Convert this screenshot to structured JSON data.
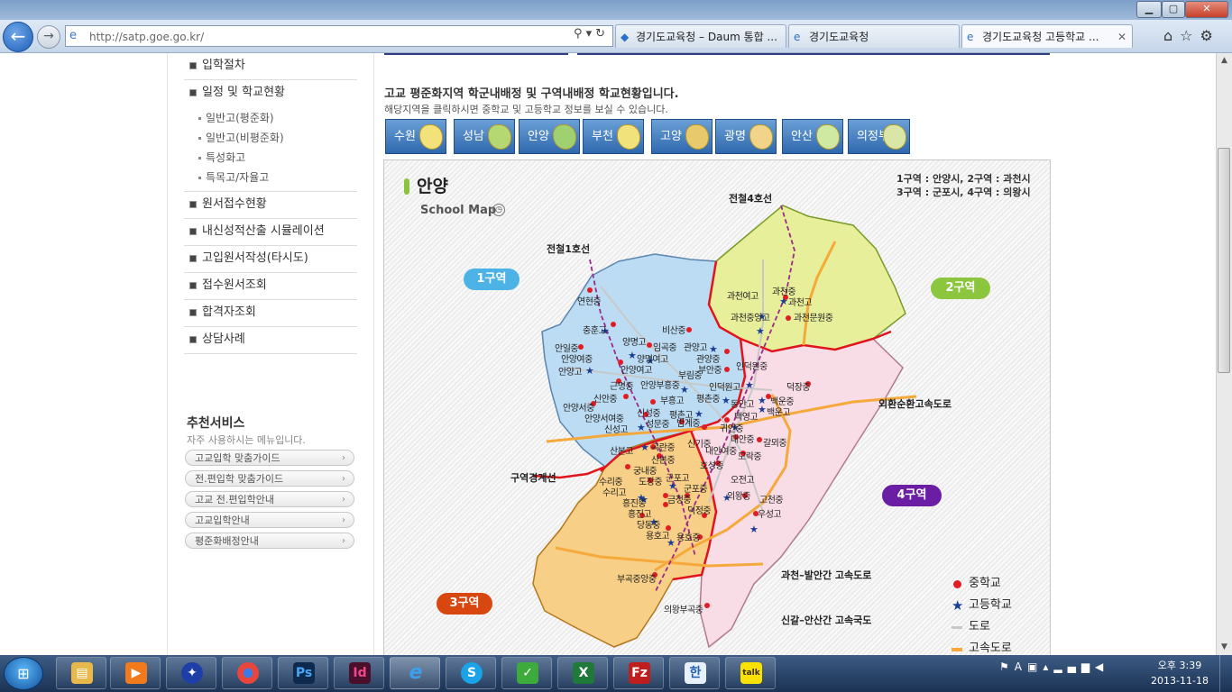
{
  "browser": {
    "address": "http://satp.goe.go.kr/",
    "tabs": [
      {
        "title": "경기도교육청 – Daum 통합 ..."
      },
      {
        "title": "경기도교육청"
      },
      {
        "title": "경기도교육청 고등학교 ...",
        "active": true
      }
    ]
  },
  "sidebar": {
    "menu_top": [
      {
        "label": "입학절차"
      },
      {
        "label": "일정 및 학교현황"
      }
    ],
    "sub_items": [
      "일반고(평준화)",
      "일반고(비평준화)",
      "특성화고",
      "특목고/자율고"
    ],
    "menu_bottom": [
      {
        "label": "원서접수현황"
      },
      {
        "label": "내신성적산출 시뮬레이션"
      },
      {
        "label": "고입원서작성(타시도)"
      },
      {
        "label": "접수원서조회"
      },
      {
        "label": "합격자조회"
      },
      {
        "label": "상담사례"
      }
    ],
    "recommend": {
      "title": "추천서비스",
      "desc": "자주 사용하시는 메뉴입니다.",
      "buttons": [
        "고교입학 맞춤가이드",
        "전.편입학 맞춤가이드",
        "고교 전.편입학안내",
        "고교입학안내",
        "평준화배정안내"
      ]
    }
  },
  "content": {
    "heading": "고교 평준화지역 학군내배정 및 구역내배정 학교현황입니다.",
    "desc": "해당지역을 클릭하시면 중학교 및 고등학교 정보를 보실 수 있습니다.",
    "regions": [
      "수원",
      "성남",
      "안양",
      "부천",
      "고양",
      "광명",
      "안산",
      "의정부"
    ],
    "region_colors": [
      "#f3e27a",
      "#b5d872",
      "#9fd173",
      "#f2e27b",
      "#e8c96c",
      "#f1d48a",
      "#cfe8a2",
      "#d9e6a6"
    ]
  },
  "map": {
    "title": "안양",
    "subtitle": "School Map",
    "district_note_1": "1구역 : 안양시, 2구역 : 과천시",
    "district_note_2": "3구역 : 군포시, 4구역 : 의왕시",
    "districts": [
      {
        "label": "1구역",
        "color": "#4db3e6"
      },
      {
        "label": "2구역",
        "color": "#8cc63f"
      },
      {
        "label": "3구역",
        "color": "#d7470f"
      },
      {
        "label": "4구역",
        "color": "#6a1ea3"
      }
    ],
    "lines": {
      "line4": "전철4호선",
      "line1": "전철1호선",
      "border": "구역경계선",
      "ring": "외환순환고속도로",
      "gwacheon_balan": "과천–발안간 고속도로",
      "singal_ansan": "신갈–안산간 고속국도"
    },
    "legend": [
      "중학교",
      "고등학교",
      "도로",
      "고속도로"
    ],
    "schools": [
      "과천여고",
      "과천중",
      "과천고",
      "과천중앙고",
      "과천문원중",
      "연현중",
      "충훈고",
      "비산중",
      "안일중",
      "안양여중",
      "안양고",
      "양명고",
      "임곡중",
      "양명여고",
      "안양여고",
      "관양고",
      "관양중",
      "부안중",
      "인덕원중",
      "부림중",
      "인덕원고",
      "안양부흥중",
      "근명중",
      "부흥고",
      "평촌중",
      "동안고",
      "신안중",
      "안양서중",
      "안양서여중",
      "신성중",
      "신성고",
      "성문중",
      "평촌고",
      "범계중",
      "백영고",
      "귀인중",
      "대안중",
      "갈뫼중",
      "덕장중",
      "백운중",
      "백운고",
      "산본고",
      "곡란중",
      "신기중",
      "내안여중",
      "모락중",
      "산본중",
      "호성중",
      "궁내중",
      "수리중",
      "도장중",
      "군포고",
      "수리고",
      "군포중",
      "금정중",
      "흥진중",
      "흥진고",
      "덕정중",
      "당동중",
      "용호고",
      "용호중",
      "오전고",
      "의왕중",
      "고천중",
      "우성고",
      "부곡중앙중",
      "의왕부곡중"
    ]
  },
  "taskbar": {
    "apps": [
      "files",
      "media",
      "compass",
      "chrome",
      "Ps",
      "Id",
      "ie",
      "skype",
      "v3",
      "excel",
      "filezilla",
      "hangul",
      "talk"
    ],
    "clock_time": "오후 3:39",
    "clock_date": "2013-11-18"
  }
}
